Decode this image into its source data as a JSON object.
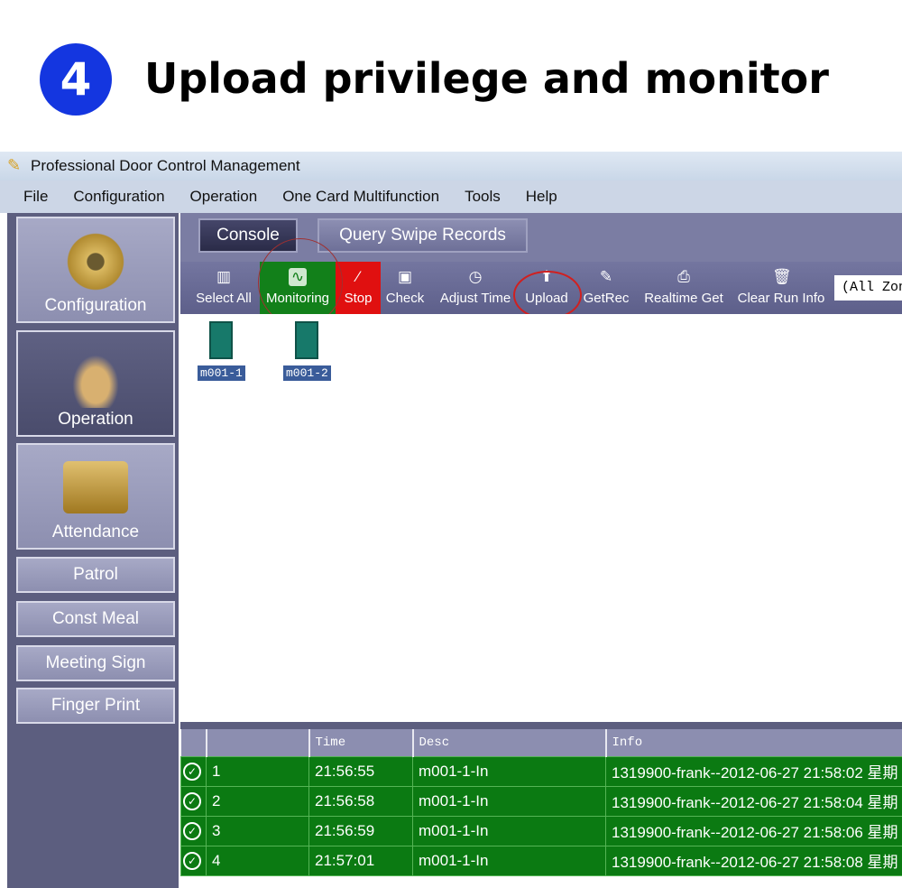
{
  "step_number": "4",
  "headline": "Upload privilege and monitor",
  "window_title": "Professional Door Control Management",
  "menu": [
    "File",
    "Configuration",
    "Operation",
    "One Card Multifunction",
    "Tools",
    "Help"
  ],
  "sidebar": [
    {
      "label": "Configuration",
      "icon": "gear-icon"
    },
    {
      "label": "Operation",
      "icon": "hand-pointer-icon"
    },
    {
      "label": "Attendance",
      "icon": "id-card-icon"
    },
    {
      "label": "Patrol"
    },
    {
      "label": "Const Meal"
    },
    {
      "label": "Meeting Sign"
    },
    {
      "label": "Finger Print"
    }
  ],
  "tabs": [
    "Console",
    "Query Swipe Records"
  ],
  "toolbar": [
    {
      "label": "Select All",
      "glyph": "▥"
    },
    {
      "label": "Monitoring",
      "glyph": "∿"
    },
    {
      "label": "Stop",
      "glyph": "⁄"
    },
    {
      "label": "Check",
      "glyph": "▣"
    },
    {
      "label": "Adjust Time",
      "glyph": "◷"
    },
    {
      "label": "Upload",
      "glyph": "⬆"
    },
    {
      "label": "GetRec",
      "glyph": "✎"
    },
    {
      "label": "Realtime Get",
      "glyph": "⎙"
    },
    {
      "label": "Clear Run Info",
      "glyph": "🗑"
    }
  ],
  "zone_filter": "(All Zones)",
  "doors": [
    "m001-1",
    "m001-2"
  ],
  "grid": {
    "headers": [
      "",
      "",
      "Time",
      "Desc",
      "Info"
    ],
    "rows": [
      [
        "1",
        "21:56:55",
        "m001-1-In",
        "1319900-frank--2012-06-27 21:58:02 星期"
      ],
      [
        "2",
        "21:56:58",
        "m001-1-In",
        "1319900-frank--2012-06-27 21:58:04 星期"
      ],
      [
        "3",
        "21:56:59",
        "m001-1-In",
        "1319900-frank--2012-06-27 21:58:06 星期"
      ],
      [
        "4",
        "21:57:01",
        "m001-1-In",
        "1319900-frank--2012-06-27 21:58:08 星期"
      ]
    ]
  },
  "colors": {
    "accent": "#1436e0",
    "monitoring": "#0b7a12",
    "stop": "#e01010",
    "highlight_circle": "#d02020"
  }
}
